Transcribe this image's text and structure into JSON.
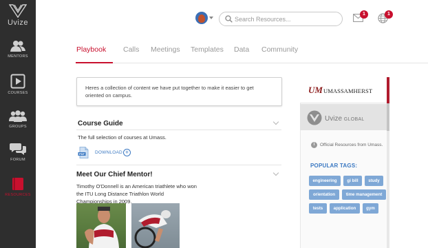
{
  "app": {
    "logo_text": "Uvize"
  },
  "sidebar": {
    "items": [
      {
        "label": "Mentors",
        "icon": "mentors-icon"
      },
      {
        "label": "Courses",
        "icon": "courses-icon"
      },
      {
        "label": "Groups",
        "icon": "groups-icon"
      },
      {
        "label": "Forum",
        "icon": "forum-icon"
      },
      {
        "label": "Resources",
        "icon": "resources-icon",
        "active": true
      }
    ]
  },
  "header": {
    "search_placeholder": "Search Resources...",
    "mail_count": "1",
    "notifications_count": "1"
  },
  "tabs": [
    {
      "label": "Playbook",
      "active": true
    },
    {
      "label": "Calls"
    },
    {
      "label": "Meetings"
    },
    {
      "label": "Templates"
    },
    {
      "label": "Data"
    },
    {
      "label": "Community"
    }
  ],
  "main": {
    "notice": "Heres a collection of content we have put together to make it easier to get oriented on campus.",
    "course_guide": {
      "title": "Course Guide",
      "description": "The full selection of courses at Umass.",
      "download_label": "Download",
      "file_icon": "pdf-icon"
    },
    "chief_mentor": {
      "title": "Meet Our Chief Mentor!",
      "description": "Timothy O'Donnell is an American triathlete who won the ITU Long Distance Triathlon World Championships in 2009."
    }
  },
  "right_panel": {
    "umass": {
      "mark": "UM",
      "name": "UMASSAMHERST"
    },
    "uvize": {
      "name": "Uvize",
      "suffix": "GLOBAL"
    },
    "official_text": "Official Resources from Umass.",
    "popular_tags_title": "Popular Tags:",
    "tags": [
      "engineering",
      "gi bill",
      "study",
      "orientation",
      "time management",
      "tests",
      "application",
      "gym"
    ]
  },
  "colors": {
    "accent": "#c8102e",
    "link": "#3a78c2",
    "tag": "#7fa8d6",
    "sidebar": "#2e2e2e"
  }
}
